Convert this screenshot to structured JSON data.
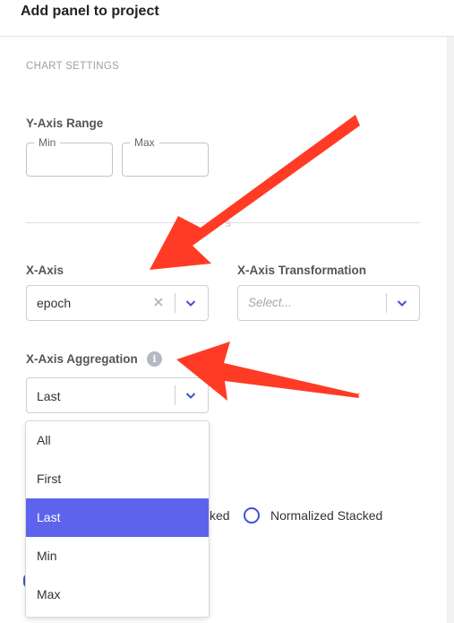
{
  "header": {
    "title": "Add panel to project"
  },
  "chart_settings": {
    "section_title": "CHART SETTINGS",
    "y_axis_range": {
      "label": "Y-Axis Range",
      "min_label": "Min",
      "max_label": "Max",
      "min_value": "",
      "max_value": ""
    },
    "divider_ghost_text": "s"
  },
  "x_axis": {
    "label": "X-Axis",
    "value": "epoch"
  },
  "x_axis_transformation": {
    "label": "X-Axis Transformation",
    "placeholder": "Select..."
  },
  "x_axis_aggregation": {
    "label": "X-Axis Aggregation",
    "value": "Last",
    "info_glyph": "i",
    "options": [
      "All",
      "First",
      "Last",
      "Min",
      "Max"
    ],
    "selected_index": 2
  },
  "stacking": {
    "partial_label": "ked",
    "normalized_label": "Normalized Stacked"
  },
  "colors": {
    "accent": "#5d63ec",
    "radio": "#3f51d6",
    "annotation_arrow": "#ff3b25",
    "chevron": "#3f51d6"
  },
  "icons": {
    "clear": "close-icon",
    "dropdown": "chevron-down-icon",
    "info": "info-icon"
  }
}
